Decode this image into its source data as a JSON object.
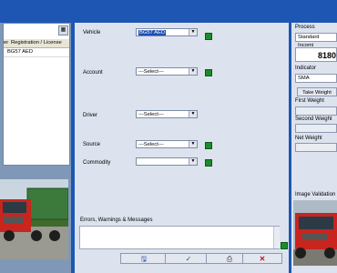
{
  "left": {
    "grid_button_icon": "grid-icon",
    "columns": [
      "Registration / License"
    ],
    "rows": [
      {
        "registration": "BG57 AED"
      }
    ],
    "column_stub": "er"
  },
  "form": {
    "vehicle": {
      "label": "Vehicle",
      "value": "BG57 AED"
    },
    "account": {
      "label": "Account",
      "value": "---Select---"
    },
    "driver": {
      "label": "Driver",
      "value": "---Select---"
    },
    "source": {
      "label": "Source",
      "value": "---Select---"
    },
    "commodity": {
      "label": "Commodity",
      "value": ""
    },
    "errors_label": "Errors, Warnings & Messages",
    "indicator_color": "#1a8c2a"
  },
  "right": {
    "process_label": "Process",
    "process_value": "Standard Incomi",
    "weight_value": "8180",
    "indicator_label": "Indicator",
    "indicator_value": "SMA",
    "take_weight_label": "Take Weight",
    "first_weight_label": "First Weight",
    "second_weight_label": "Second Weight",
    "net_weight_label": "Net Weight",
    "image_validation_label": "Image Validation"
  },
  "buttons": [
    {
      "name": "save",
      "icon": "save-icon",
      "glyph": "🖫",
      "color": "#1b3c9a"
    },
    {
      "name": "confirm",
      "icon": "check-icon",
      "glyph": "✓",
      "color": "#2d6b2d"
    },
    {
      "name": "print",
      "icon": "printer-icon",
      "glyph": "⎙",
      "color": "#333333"
    },
    {
      "name": "cancel",
      "icon": "close-icon",
      "glyph": "✕",
      "color": "#c0121a"
    }
  ]
}
